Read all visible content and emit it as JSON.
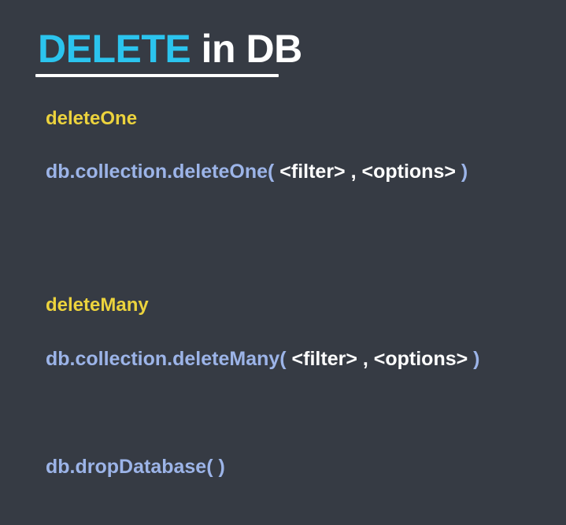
{
  "title": {
    "accent": "DELETE",
    "rest": " in DB"
  },
  "sections": [
    {
      "heading": "deleteOne",
      "call": "db.collection.deleteOne(",
      "args": " <filter> , <options> ",
      "close": ")"
    },
    {
      "heading": "deleteMany",
      "call": "db.collection.deleteMany(",
      "args": " <filter> , <options> ",
      "close": ")"
    }
  ],
  "drop": {
    "call": "db.dropDatabase( )"
  },
  "colors": {
    "background": "#363b44",
    "title_accent": "#2bc4ee",
    "heading": "#ecd33d",
    "code": "#9cb4e8",
    "args": "#ffffff"
  }
}
